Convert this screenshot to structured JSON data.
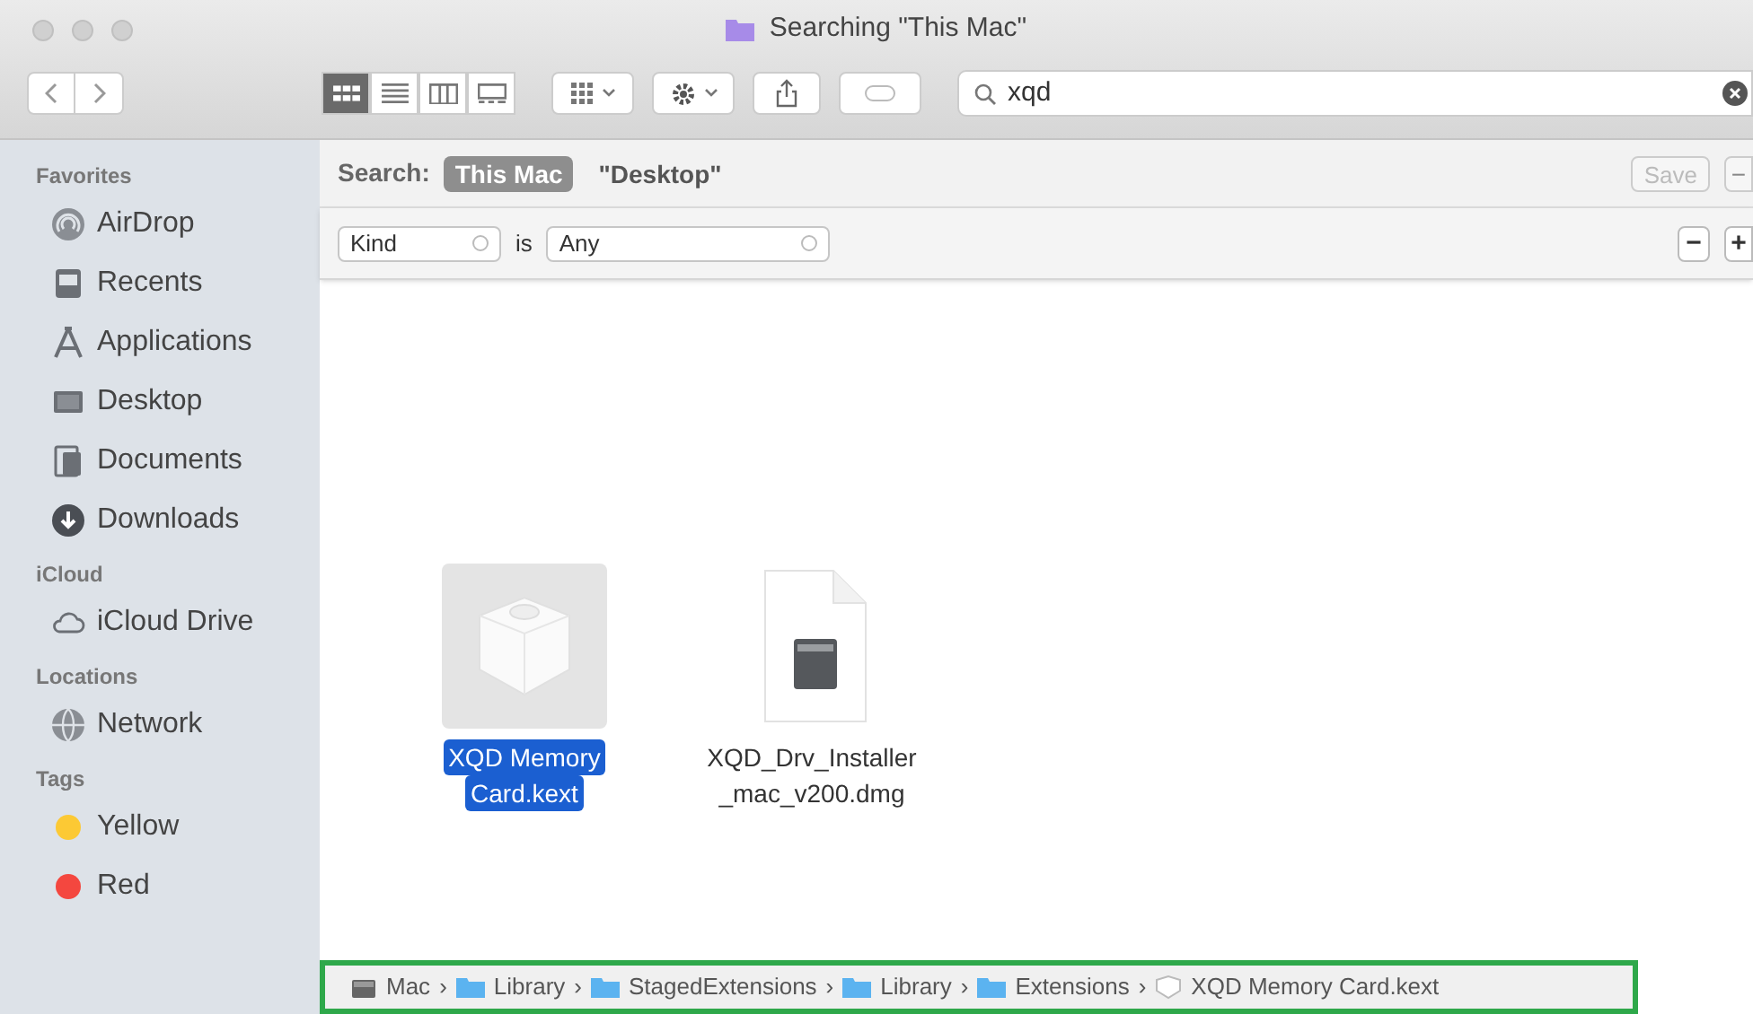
{
  "window": {
    "title": "Searching \"This Mac\""
  },
  "toolbar": {
    "view_modes": [
      {
        "selected": true
      },
      {
        "selected": false
      },
      {
        "selected": false
      },
      {
        "selected": false
      }
    ],
    "search": {
      "value": "xqd"
    }
  },
  "sidebar": [
    {
      "heading": "Favorites",
      "items": [
        {
          "label": "AirDrop",
          "kind": "airdrop"
        },
        {
          "label": "Recents",
          "kind": "recents"
        },
        {
          "label": "Applications",
          "kind": "apps"
        },
        {
          "label": "Desktop",
          "kind": "desktop"
        },
        {
          "label": "Documents",
          "kind": "documents"
        },
        {
          "label": "Downloads",
          "kind": "downloads"
        }
      ]
    },
    {
      "heading": "iCloud",
      "items": [
        {
          "label": "iCloud Drive",
          "kind": "cloud"
        }
      ]
    },
    {
      "heading": "Locations",
      "items": [
        {
          "label": "Network",
          "kind": "network"
        }
      ]
    },
    {
      "heading": "Tags",
      "items": [
        {
          "label": "Yellow",
          "kind": "tag",
          "color": "#fcc934"
        },
        {
          "label": "Red",
          "kind": "tag",
          "color": "#f4473f"
        }
      ]
    }
  ],
  "search_bar": {
    "label": "Search:",
    "scopes": [
      {
        "label": "This Mac",
        "selected": true
      },
      {
        "label": "\"Desktop\"",
        "selected": false
      }
    ],
    "save_button": "Save",
    "remove_button": "−"
  },
  "filter": {
    "attribute": "Kind",
    "operator": "is",
    "value": "Any",
    "remove_button": "−",
    "add_button": "+"
  },
  "files": [
    {
      "lines": [
        "XQD Memory",
        "Card.kext"
      ],
      "kind": "kext",
      "selected": true
    },
    {
      "lines": [
        "XQD_Drv_Installer",
        "_mac_v200.dmg"
      ],
      "kind": "dmg",
      "selected": false
    }
  ],
  "path_bar": [
    {
      "label": "Mac",
      "kind": "disk",
      "separator": "›"
    },
    {
      "label": "Library",
      "kind": "folder",
      "separator": "›"
    },
    {
      "label": "StagedExtensions",
      "kind": "folder",
      "separator": "›"
    },
    {
      "label": "Library",
      "kind": "folder",
      "separator": "›"
    },
    {
      "label": "Extensions",
      "kind": "folder",
      "separator": "›"
    },
    {
      "label": "XQD Memory Card.kext",
      "kind": "kext"
    }
  ]
}
